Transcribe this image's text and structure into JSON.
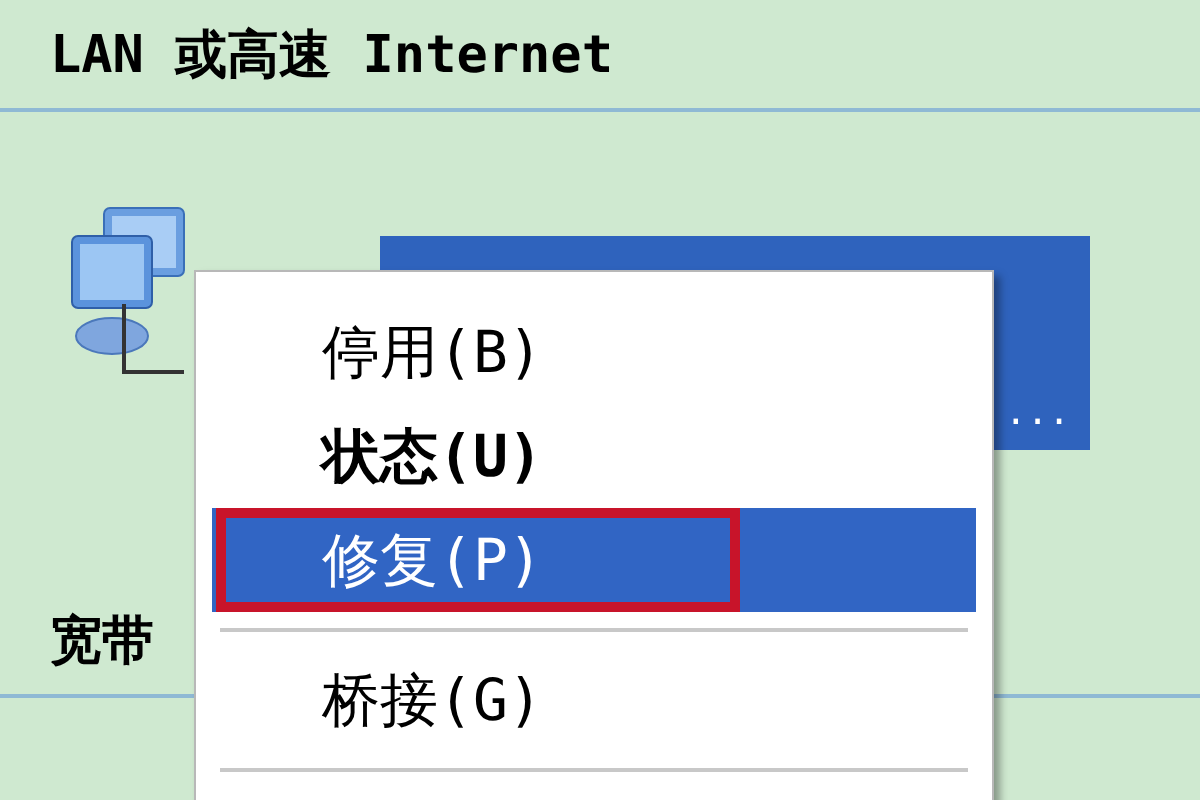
{
  "sections": [
    {
      "title": "LAN 或高速 Internet"
    },
    {
      "title": "宽带"
    }
  ],
  "connection": {
    "selected": true,
    "name_tail": "..."
  },
  "context_menu": {
    "items": [
      {
        "kind": "item",
        "label": "停用(B)",
        "default": false,
        "selected": false,
        "highlighted_box": false
      },
      {
        "kind": "item",
        "label": "状态(U)",
        "default": true,
        "selected": false,
        "highlighted_box": false
      },
      {
        "kind": "item",
        "label": "修复(P)",
        "default": false,
        "selected": true,
        "highlighted_box": true
      },
      {
        "kind": "separator"
      },
      {
        "kind": "item",
        "label": "桥接(G)",
        "default": false,
        "selected": false,
        "highlighted_box": false
      },
      {
        "kind": "separator"
      }
    ]
  }
}
